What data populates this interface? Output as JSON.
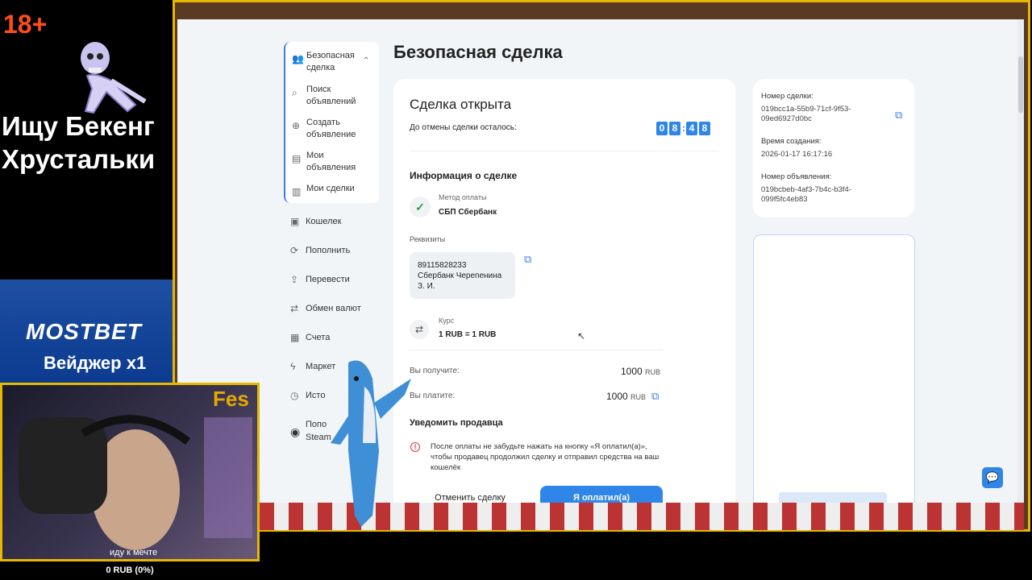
{
  "overlay": {
    "age_badge": "18+",
    "title_line1": "Ищу Бекенг",
    "title_line2": "Хрустальки",
    "promo_brand": "MOSTBET",
    "promo_wager": "Вейджер x1",
    "webcam_label": "Fes",
    "goal_text": "иду к мечте",
    "goal_amount": "0 RUB (0%)"
  },
  "sidebar": {
    "group": [
      {
        "label": "Безопасная сделка",
        "icon": "users-icon"
      },
      {
        "label": "Поиск объявлений",
        "icon": "search-icon"
      },
      {
        "label": "Создать объявление",
        "icon": "plus-circle-icon"
      },
      {
        "label": "Мои объявления",
        "icon": "document-icon"
      },
      {
        "label": "Мои сделки",
        "icon": "deals-icon"
      }
    ],
    "items": [
      {
        "label": "Кошелек",
        "icon": "wallet-icon"
      },
      {
        "label": "Пополнить",
        "icon": "topup-icon"
      },
      {
        "label": "Перевести",
        "icon": "transfer-icon"
      },
      {
        "label": "Обмен валют",
        "icon": "exchange-icon"
      },
      {
        "label": "Счета",
        "icon": "accounts-icon"
      },
      {
        "label": "Маркет",
        "icon": "lightning-icon"
      },
      {
        "label": "Исто",
        "icon": "history-icon"
      },
      {
        "label": "Попо",
        "label2": "Steam",
        "icon": "steam-icon"
      }
    ]
  },
  "main": {
    "page_title": "Безопасная сделка",
    "status": "Сделка открыта",
    "countdown_label": "До отмены сделки осталось:",
    "timer_digits": [
      "0",
      "8",
      "4",
      "8"
    ],
    "info_heading": "Информация о сделке",
    "payment_method_label": "Метод оплаты",
    "payment_method_value": "СБП Сбербанк",
    "requisites_label": "Реквизиты",
    "requisites_lines": [
      "89115828233",
      "Сбербанк Черепенина",
      "З. И."
    ],
    "rate_label": "Курс",
    "rate_value": "1 RUB = 1 RUB",
    "receive_label": "Вы получите:",
    "receive_amount": "1000",
    "receive_currency": "RUB",
    "pay_label": "Вы платите:",
    "pay_amount": "1000",
    "pay_currency": "RUB",
    "notify_heading": "Уведомить продавца",
    "notify_text": "После оплаты не забудьте нажать на кнопку «Я оплатил(а)», чтобы продавец продолжил сделку и отправил средства на ваш кошелёк",
    "cancel_button": "Отменить сделку",
    "paid_button": "Я оплатил(а)"
  },
  "meta": {
    "deal_number_label": "Номер сделки:",
    "deal_number_line1": "019bcc1a-55b9-71cf-9f53-",
    "deal_number_line2": "09ed6927d0bc",
    "created_label": "Время создания:",
    "created_value": "2026-01-17 16:17:16",
    "ad_number_label": "Номер объявления:",
    "ad_number_line1": "019bcbeb-4af3-7b4c-b3f4-",
    "ad_number_line2": "099f5fc4eb83"
  },
  "colors": {
    "accent": "#2f86e8",
    "frame": "#e6b800",
    "warning": "#e03a3a",
    "badge": "#ff4d1a"
  }
}
